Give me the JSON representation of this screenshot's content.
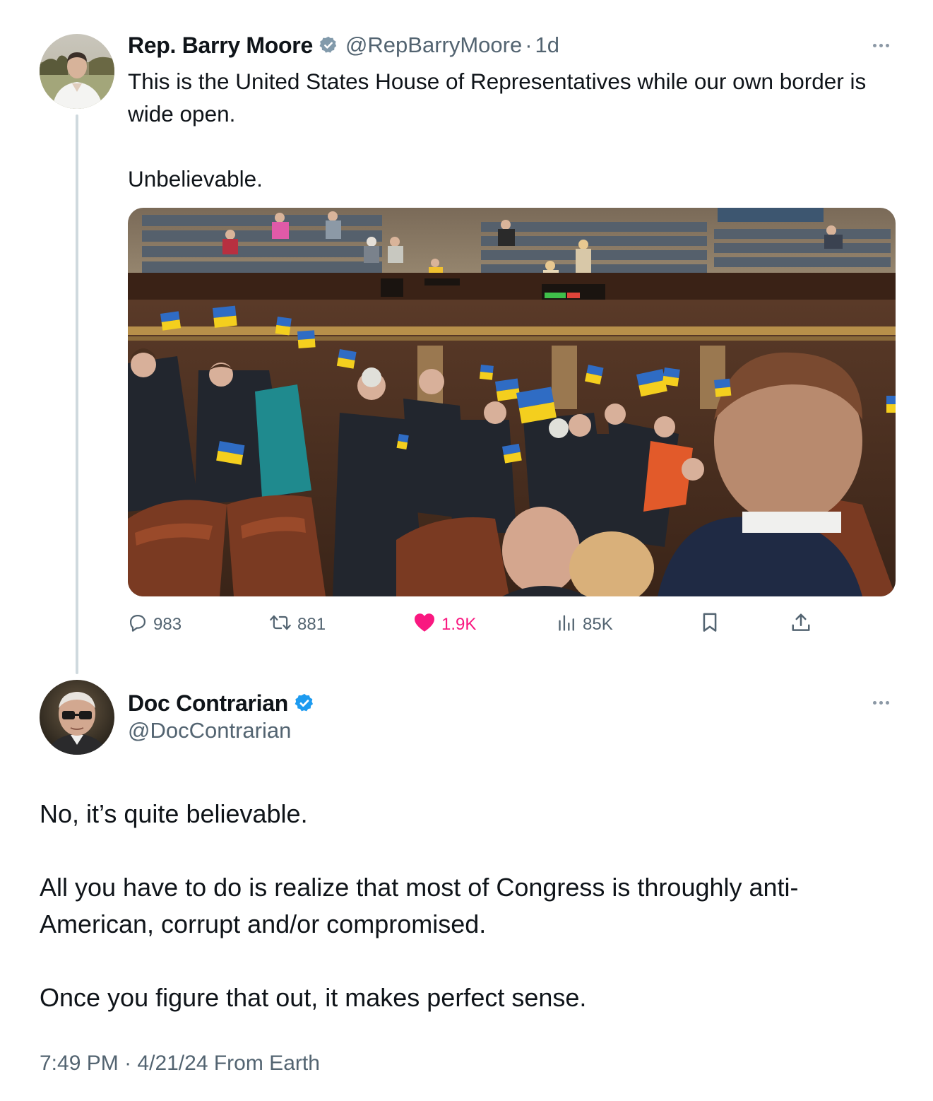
{
  "parent_tweet": {
    "author_name": "Rep. Barry Moore",
    "handle": "@RepBarryMoore",
    "separator": "·",
    "time": "1d",
    "text_lines": [
      "This is the United States House of Representatives while our own border is wide open.",
      "Unbelievable."
    ],
    "stats": {
      "replies": "983",
      "reposts": "881",
      "likes": "1.9K",
      "views": "85K"
    }
  },
  "reply_tweet": {
    "author_name": "Doc Contrarian",
    "handle": "@DocContrarian",
    "paragraphs": [
      "No, it’s quite believable.",
      "All you have to do is realize that most of Congress is throughly anti-American, corrupt and/or compromised.",
      "Once you figure that out, it makes perfect sense."
    ],
    "timestamp": "7:49 PM",
    "separator": "·",
    "date": "4/21/24",
    "source": "From Earth"
  },
  "colors": {
    "text_primary": "#0f1419",
    "text_secondary": "#536471",
    "verified_blue": "#1d9bf0",
    "verified_gov_gray": "#829aab",
    "like_pink": "#f91880",
    "ukraine_blue": "#2f6cc4",
    "ukraine_yellow": "#f4cf1e"
  },
  "icons": [
    "reply-icon",
    "repost-icon",
    "like-heart-icon",
    "views-icon",
    "bookmark-icon",
    "share-icon",
    "more-icon",
    "verified-badge-icon"
  ]
}
